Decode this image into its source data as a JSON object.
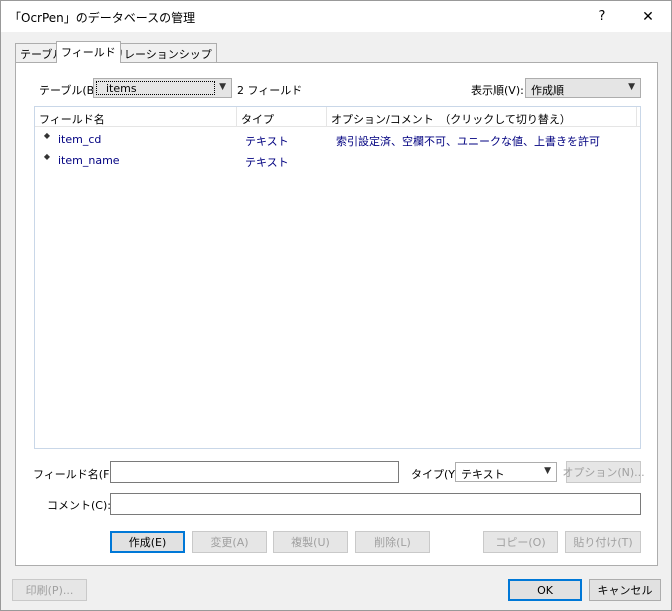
{
  "window": {
    "title": "「OcrPen」のデータベースの管理",
    "help": "?",
    "close": "✕"
  },
  "tabs": [
    {
      "label": "テーブル"
    },
    {
      "label": "フィールド"
    },
    {
      "label": "リレーションシップ"
    }
  ],
  "table_select": {
    "label": "テーブル(B):",
    "value": "items",
    "count": "2 フィールド"
  },
  "sort": {
    "label": "表示順(V):",
    "value": "作成順"
  },
  "list": {
    "columns": [
      "フィールド名",
      "タイプ",
      "オプション/コメント　（クリックして切り替え）"
    ],
    "rows": [
      {
        "name": "item_cd",
        "type": "テキスト",
        "options": "索引設定済、空欄不可、ユニークな値、上書きを許可"
      },
      {
        "name": "item_name",
        "type": "テキスト",
        "options": ""
      }
    ]
  },
  "form": {
    "field_name_label": "フィールド名(F):",
    "field_name_value": "",
    "type_label": "タイプ(Y):",
    "type_value": "テキスト",
    "options_button": "オプション(N)...",
    "comment_label": "コメント(C):",
    "comment_value": ""
  },
  "actions": {
    "create": "作成(E)",
    "change": "変更(A)",
    "duplicate": "複製(U)",
    "delete": "削除(L)",
    "copy": "コピー(O)",
    "paste": "貼り付け(T)"
  },
  "footer": {
    "print": "印刷(P)...",
    "ok": "OK",
    "cancel": "キャンセル"
  },
  "icons": {
    "arrow": "▼",
    "key": "◆"
  }
}
